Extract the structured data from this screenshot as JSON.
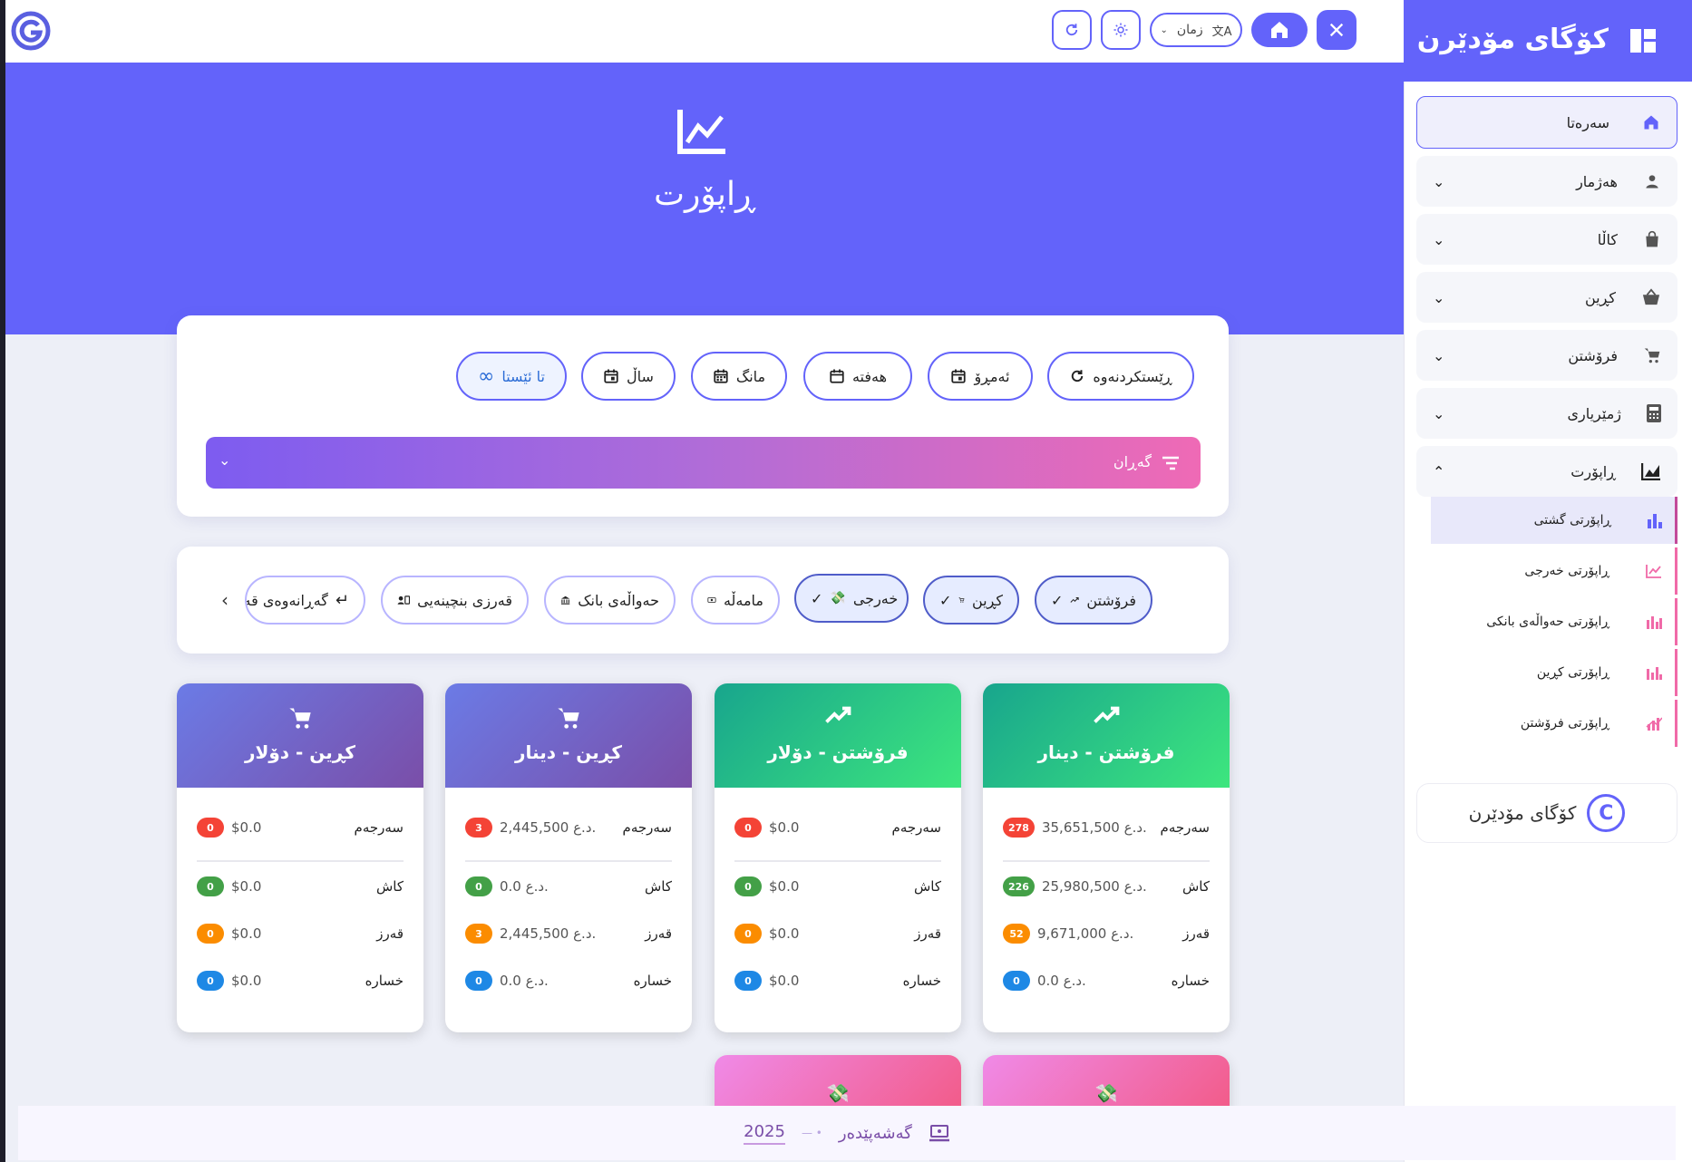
{
  "topbar": {
    "language_label": "زمان"
  },
  "hero": {
    "title": "ڕاپۆرت"
  },
  "date_filters": [
    {
      "label": "ڕێستکردنەوە"
    },
    {
      "label": "ئەمڕۆ"
    },
    {
      "label": "هەفتە"
    },
    {
      "label": "مانگ"
    },
    {
      "label": "ساڵ"
    },
    {
      "label": "تا ئێستا"
    }
  ],
  "search_bar": {
    "label": "گەڕان"
  },
  "type_tabs": [
    {
      "label": "فرۆشتن"
    },
    {
      "label": "کڕین"
    },
    {
      "label": "خەرجی"
    },
    {
      "label": "مامەڵە"
    },
    {
      "label": "حەواڵەی بانک"
    },
    {
      "label": "قەرزی بنچینەیی"
    },
    {
      "label": "گەڕانەوەی قە"
    }
  ],
  "cards": [
    {
      "title": "فرۆشتن - دینار",
      "rows": [
        {
          "label": "سەرجەم",
          "value": "35,651,500 د.ع.",
          "count": "278"
        },
        {
          "label": "کاش",
          "value": "25,980,500 د.ع.",
          "count": "226"
        },
        {
          "label": "قەرز",
          "value": "9,671,000 د.ع.",
          "count": "52"
        },
        {
          "label": "خسارە",
          "value": "0.0 د.ع.",
          "count": "0"
        }
      ]
    },
    {
      "title": "فرۆشتن - دۆلار",
      "rows": [
        {
          "label": "سەرجەم",
          "value": "$0.0",
          "count": "0"
        },
        {
          "label": "کاش",
          "value": "$0.0",
          "count": "0"
        },
        {
          "label": "قەرز",
          "value": "$0.0",
          "count": "0"
        },
        {
          "label": "خسارە",
          "value": "$0.0",
          "count": "0"
        }
      ]
    },
    {
      "title": "کڕین - دینار",
      "rows": [
        {
          "label": "سەرجەم",
          "value": "2,445,500 د.ع.",
          "count": "3"
        },
        {
          "label": "کاش",
          "value": "0.0 د.ع.",
          "count": "0"
        },
        {
          "label": "قەرز",
          "value": "2,445,500 د.ع.",
          "count": "3"
        },
        {
          "label": "خسارە",
          "value": "0.0 د.ع.",
          "count": "0"
        }
      ]
    },
    {
      "title": "کڕین - دۆلار",
      "rows": [
        {
          "label": "سەرجەم",
          "value": "$0.0",
          "count": "0"
        },
        {
          "label": "کاش",
          "value": "$0.0",
          "count": "0"
        },
        {
          "label": "قەرز",
          "value": "$0.0",
          "count": "0"
        },
        {
          "label": "خسارە",
          "value": "$0.0",
          "count": "0"
        }
      ]
    }
  ],
  "sidebar": {
    "brand": "کۆگای مۆدێرن",
    "items": [
      {
        "label": "سەرەتا"
      },
      {
        "label": "هەژمار"
      },
      {
        "label": "کاڵا"
      },
      {
        "label": "کڕین"
      },
      {
        "label": "فرۆشتن"
      },
      {
        "label": "ژمێریاری"
      },
      {
        "label": "ڕاپۆرت"
      }
    ],
    "report_sub": [
      {
        "label": "ڕاپۆرتی گشتی"
      },
      {
        "label": "ڕاپۆرتی خەرجی"
      },
      {
        "label": "ڕاپۆرتی حەواڵەی بانکی"
      },
      {
        "label": "ڕاپۆرتی کڕین"
      },
      {
        "label": "ڕاپۆرتی فرۆشتن"
      }
    ],
    "footer_brand": "کۆگای مۆدێرن"
  },
  "footer": {
    "developer": "گەشەپێدەر",
    "year": "2025"
  },
  "colors": {
    "accent": "#6363fa",
    "green": "#18a58d",
    "purple": "#7a4ea8",
    "pink": "#f25a86"
  }
}
